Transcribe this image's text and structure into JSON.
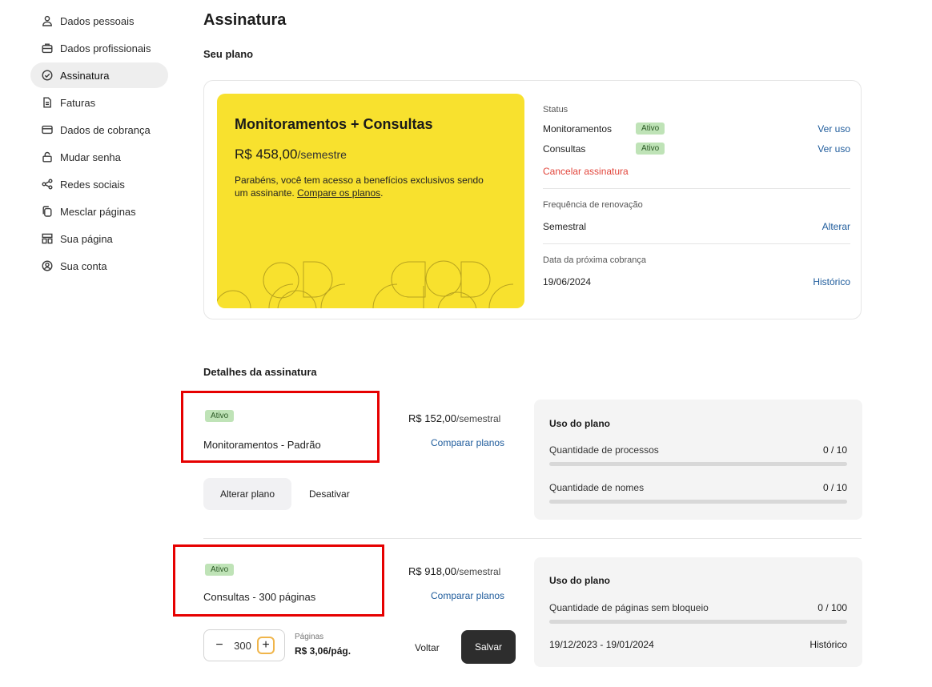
{
  "sidebar": {
    "items": [
      {
        "label": "Dados pessoais",
        "icon": "user-icon"
      },
      {
        "label": "Dados profissionais",
        "icon": "briefcase-icon"
      },
      {
        "label": "Assinatura",
        "icon": "check-circle-icon",
        "active": true
      },
      {
        "label": "Faturas",
        "icon": "document-icon"
      },
      {
        "label": "Dados de cobrança",
        "icon": "credit-card-icon"
      },
      {
        "label": "Mudar senha",
        "icon": "lock-icon"
      },
      {
        "label": "Redes sociais",
        "icon": "share-icon"
      },
      {
        "label": "Mesclar páginas",
        "icon": "copy-icon"
      },
      {
        "label": "Sua página",
        "icon": "layout-icon"
      },
      {
        "label": "Sua conta",
        "icon": "account-circle-icon"
      }
    ]
  },
  "page": {
    "title": "Assinatura",
    "plan_section_title": "Seu plano",
    "details_section_title": "Detalhes da assinatura"
  },
  "plan": {
    "name": "Monitoramentos + Consultas",
    "price": "R$ 458,00",
    "period": "/semestre",
    "description": "Parabéns, você tem acesso a benefícios exclusivos sendo um assinante.",
    "compare_link": "Compare os planos",
    "accent_color": "#f8e12e"
  },
  "status": {
    "label": "Status",
    "rows": [
      {
        "name": "Monitoramentos",
        "badge": "Ativo",
        "link": "Ver uso"
      },
      {
        "name": "Consultas",
        "badge": "Ativo",
        "link": "Ver uso"
      }
    ],
    "cancel": "Cancelar assinatura",
    "renewal_label": "Frequência de renovação",
    "renewal_value": "Semestral",
    "renewal_link": "Alterar",
    "next_charge_label": "Data da próxima cobrança",
    "next_charge_value": "19/06/2024",
    "history_link": "Histórico"
  },
  "details": {
    "monitoramentos": {
      "badge": "Ativo",
      "name": "Monitoramentos - Padrão",
      "price": "R$ 152,00",
      "period": "/semestral",
      "compare": "Comparar planos",
      "usage_title": "Uso do plano",
      "usage": [
        {
          "label": "Quantidade de processos",
          "value": "0 / 10",
          "fraction": 0
        },
        {
          "label": "Quantidade de nomes",
          "value": "0 / 10",
          "fraction": 0
        }
      ],
      "change_button": "Alterar plano",
      "deactivate_button": "Desativar"
    },
    "consultas": {
      "badge": "Ativo",
      "name": "Consultas - 300 páginas",
      "price": "R$ 918,00",
      "period": "/semestral",
      "compare": "Comparar planos",
      "usage_title": "Uso do plano",
      "usage": [
        {
          "label": "Quantidade de páginas sem bloqueio",
          "value": "0 / 100",
          "fraction": 0
        }
      ],
      "period_range": "19/12/2023 - 19/01/2024",
      "history_link": "Histórico",
      "stepper_value": "300",
      "stepper_minus": "−",
      "stepper_plus": "+",
      "pages_label": "Páginas",
      "price_per_page": "R$ 3,06/pág.",
      "back_button": "Voltar",
      "save_button": "Salvar"
    }
  }
}
